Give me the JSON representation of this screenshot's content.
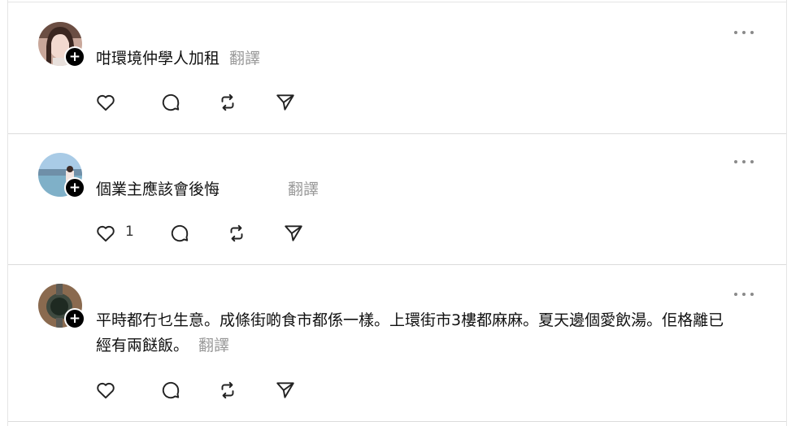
{
  "posts": [
    {
      "text": "咁環境仲學人加租",
      "translate_label": "翻譯",
      "like_count": ""
    },
    {
      "text": "個業主應該會後悔",
      "translate_label": "翻譯",
      "like_count": "1"
    },
    {
      "text": "平時都冇乜生意。成條街啲食市都係一樣。上環街市3樓都麻麻。夏天邊個愛飲湯。佢格離已經有兩餸飯。",
      "translate_label": "翻譯",
      "like_count": ""
    }
  ],
  "icons": {
    "follow": "plus-icon",
    "more": "more-dots-icon",
    "like": "heart-icon",
    "reply": "comment-bubble-icon",
    "repost": "repost-arrows-icon",
    "share": "send-paper-plane-icon"
  }
}
